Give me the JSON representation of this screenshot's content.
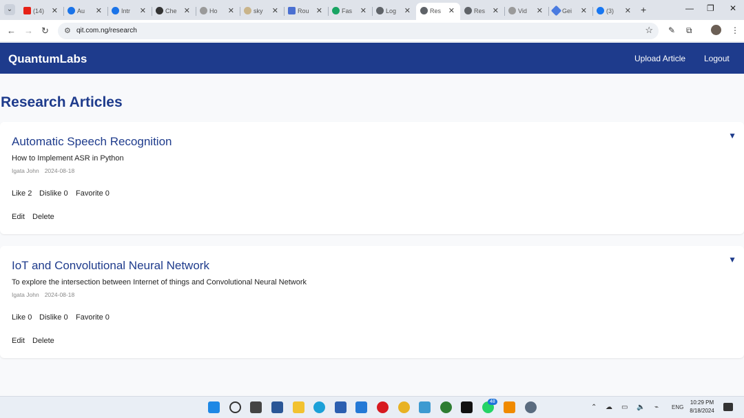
{
  "browser": {
    "tabs": [
      {
        "title": "(14)",
        "icon_color": "#e62117"
      },
      {
        "title": "Au",
        "icon_color": "#1a73e8"
      },
      {
        "title": "Intr",
        "icon_color": "#1a73e8"
      },
      {
        "title": "Che",
        "icon_color": "#333333"
      },
      {
        "title": "Ho",
        "icon_color": "#9a9a9a"
      },
      {
        "title": "sky",
        "icon_color": "#c9b48a"
      },
      {
        "title": "Rou",
        "icon_color": "#4a6fd1"
      },
      {
        "title": "Fas",
        "icon_color": "#19a463"
      },
      {
        "title": "Log",
        "icon_color": "#5f6368"
      },
      {
        "title": "Res",
        "icon_color": "#5f6368"
      },
      {
        "title": "Res",
        "icon_color": "#5f6368"
      },
      {
        "title": "Vid",
        "icon_color": "#9a9a9a"
      },
      {
        "title": "Gei",
        "icon_color": "#4a7be0"
      },
      {
        "title": "(3)",
        "icon_color": "#1877f2"
      }
    ],
    "active_tab_index": 9,
    "url": "qit.com.ng/research"
  },
  "site": {
    "brand": "QuantumLabs",
    "nav": {
      "upload": "Upload Article",
      "logout": "Logout"
    },
    "page_title": "Research Articles",
    "articles": [
      {
        "title": "Automatic Speech Recognition",
        "description": "How to Implement ASR in Python",
        "author": "Igata John",
        "date": "2024-08-18",
        "like": "Like 2",
        "dislike": "Dislike 0",
        "favorite": "Favorite 0",
        "edit": "Edit",
        "delete": "Delete",
        "toggle": "▼"
      },
      {
        "title": "IoT and Convolutional Neural Network",
        "description": "To explore the intersection between Internet of things and Convolutional Neural Network",
        "author": "Igata John",
        "date": "2024-08-18",
        "like": "Like 0",
        "dislike": "Dislike 0",
        "favorite": "Favorite 0",
        "edit": "Edit",
        "delete": "Delete",
        "toggle": "▼"
      }
    ]
  },
  "taskbar": {
    "whatsapp_badge": "48",
    "language": "ENG",
    "time": "10:29 PM",
    "date": "8/18/2024"
  },
  "colors": {
    "header_bg": "#1e3b8c",
    "accent": "#1e3b8c",
    "page_bg": "#f8f9fb"
  }
}
